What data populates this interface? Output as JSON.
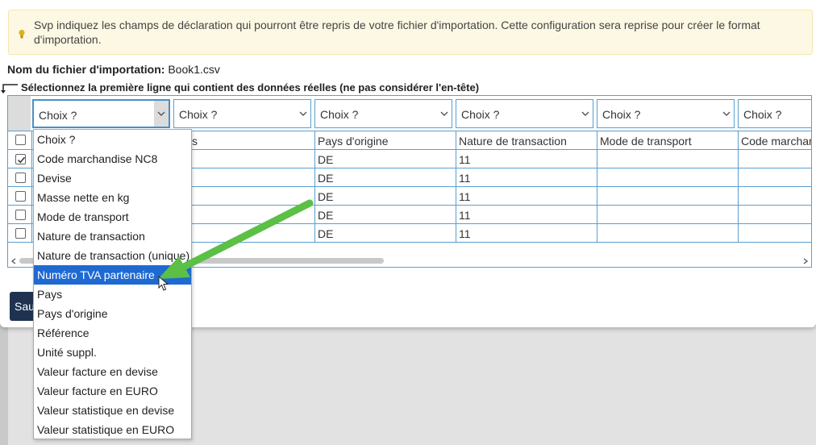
{
  "notice": {
    "text": "Svp indiquez les champs de déclaration qui pourront être repris de votre fichier d'importation. Cette configuration sera reprise pour créer le format d'importation."
  },
  "file": {
    "label": "Nom du fichier d'importation:",
    "value": "Book1.csv"
  },
  "hint": "Sélectionnez la première ligne qui contient des données réelles (ne pas considérer l'en-tête)",
  "choosers": [
    "Choix ?",
    "Choix ?",
    "Choix ?",
    "Choix ?",
    "Choix ?",
    "Choix ?"
  ],
  "table": {
    "headers": [
      "ys",
      "Pays d'origine",
      "Nature de transaction",
      "Mode de transport",
      "Code marchan"
    ],
    "rows": [
      {
        "checked": true,
        "origin": "DE",
        "nature": "11"
      },
      {
        "checked": false,
        "origin": "DE",
        "nature": "11"
      },
      {
        "checked": false,
        "origin": "DE",
        "nature": "11"
      },
      {
        "checked": false,
        "origin": "DE",
        "nature": "11"
      },
      {
        "checked": false,
        "origin": "DE",
        "nature": "11"
      }
    ]
  },
  "save_label": "Sau",
  "dropdown": {
    "selected": "Numéro TVA partenaire",
    "options": [
      "Choix ?",
      "Code marchandise NC8",
      "Devise",
      "Masse nette en kg",
      "Mode de transport",
      "Nature de transaction",
      "Nature de transaction (unique)",
      "Numéro TVA partenaire",
      "Pays",
      "Pays d'origine",
      "Référence",
      "Unité suppl.",
      "Valeur facture en devise",
      "Valeur facture en EURO",
      "Valeur statistique en devise",
      "Valeur statistique en EURO"
    ]
  },
  "colors": {
    "accent": "#5a9fce",
    "selected": "#1e6ad2",
    "annotation_arrow": "#5cbf46",
    "notice_bg": "#fcf8e3",
    "button": "#1f3350"
  }
}
